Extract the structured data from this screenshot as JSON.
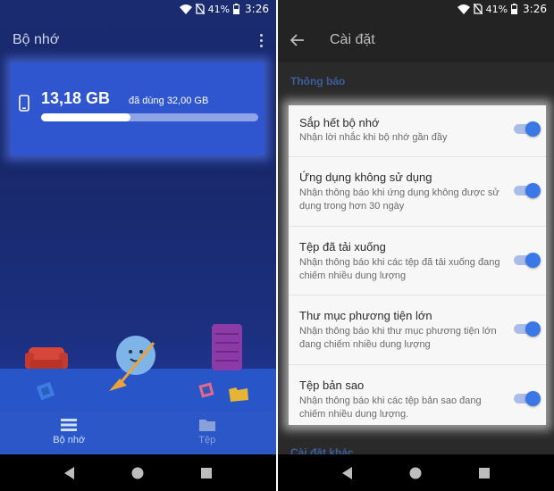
{
  "status_bar": {
    "battery": "41%",
    "time": "3:26"
  },
  "storage_screen": {
    "title": "Bộ nhớ",
    "used": "13,18 GB",
    "total_text": "đã dùng 32,00 GB",
    "used_fraction": 0.41,
    "bottom_nav": [
      {
        "label": "Bộ nhớ",
        "icon": "storage-list-icon",
        "active": true
      },
      {
        "label": "Tệp",
        "icon": "folder-icon",
        "active": false
      }
    ]
  },
  "settings_screen": {
    "title": "Cài đặt",
    "section_header": "Thông báo",
    "next_section_header": "Cài đặt khác",
    "items": [
      {
        "title": "Sắp hết bộ nhớ",
        "description": "Nhận lời nhắc khi bộ nhớ gần đầy",
        "enabled": true
      },
      {
        "title": "Ứng dụng không sử dụng",
        "description": "Nhận thông báo khi ứng dụng không được sử dụng trong hơn 30 ngày",
        "enabled": true
      },
      {
        "title": "Tệp đã tải xuống",
        "description": "Nhận thông báo khi các tệp đã tải xuống đang chiếm nhiều dung lượng",
        "enabled": true
      },
      {
        "title": "Thư mục phương tiện lớn",
        "description": "Nhận thông báo khi thư mục phương tiện lớn đang chiếm nhiều dung lượng",
        "enabled": true
      },
      {
        "title": "Tệp bản sao",
        "description": "Nhận thông báo khi các tệp bản sao đang chiếm nhiều dung lượng.",
        "enabled": true
      }
    ]
  },
  "colors": {
    "accent": "#3b78e7",
    "storage_card": "#2f56cf",
    "section_header": "#3c5f9c"
  }
}
